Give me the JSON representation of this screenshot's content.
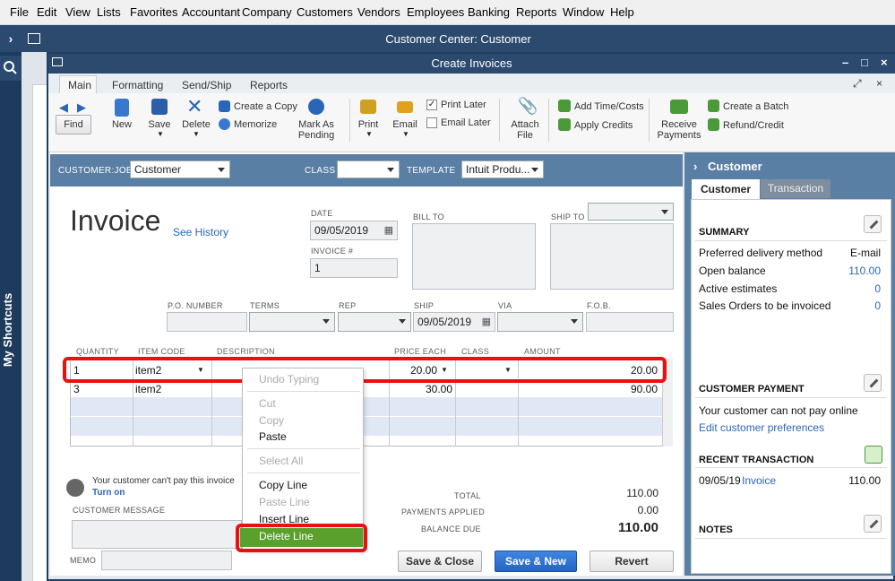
{
  "menubar": {
    "items": [
      "File",
      "Edit",
      "View",
      "Lists",
      "Favorites",
      "Accountant",
      "Company",
      "Customers",
      "Vendors",
      "Employees",
      "Banking",
      "Reports",
      "Window",
      "Help"
    ]
  },
  "shortcuts_label": "My Shortcuts",
  "customer_center_title": "Customer Center: Customer",
  "window_title": "Create Invoices",
  "ribbon_tabs": [
    "Main",
    "Formatting",
    "Send/Ship",
    "Reports"
  ],
  "toolbar": {
    "find": "Find",
    "new": "New",
    "save": "Save",
    "delete": "Delete",
    "create_copy": "Create a Copy",
    "memorize": "Memorize",
    "mark_as_pending": "Mark As Pending",
    "print": "Print",
    "email": "Email",
    "print_later": "Print Later",
    "email_later": "Email Later",
    "attach_file": "Attach File",
    "add_time_costs": "Add Time/Costs",
    "apply_credits": "Apply Credits",
    "receive_payments": "Receive Payments",
    "create_batch": "Create a Batch",
    "refund_credit": "Refund/Credit"
  },
  "header": {
    "customer_job_label": "CUSTOMER:JOB",
    "customer_job_value": "Customer",
    "class_label": "CLASS",
    "class_value": "",
    "template_label": "TEMPLATE",
    "template_value": "Intuit Produ..."
  },
  "invoice": {
    "title": "Invoice",
    "see_history": "See History",
    "date_label": "DATE",
    "date_value": "09/05/2019",
    "invoice_no_label": "INVOICE #",
    "invoice_no_value": "1",
    "bill_to_label": "BILL TO",
    "ship_to_label": "SHIP TO",
    "po_label": "P.O. NUMBER",
    "terms_label": "TERMS",
    "rep_label": "REP",
    "ship_label": "SHIP",
    "ship_value": "09/05/2019",
    "via_label": "VIA",
    "fob_label": "F.O.B."
  },
  "line_items": {
    "headers": [
      "QUANTITY",
      "ITEM CODE",
      "DESCRIPTION",
      "PRICE EACH",
      "CLASS",
      "AMOUNT"
    ],
    "rows": [
      {
        "qty": "1",
        "item": "item2",
        "desc": "",
        "price": "20.00",
        "class": "",
        "amount": "20.00"
      },
      {
        "qty": "3",
        "item": "item2",
        "desc": "",
        "price": "30.00",
        "class": "",
        "amount": "90.00"
      }
    ]
  },
  "context_menu": {
    "items": [
      "Undo Typing",
      "Cut",
      "Copy",
      "Paste",
      "Select All",
      "Copy Line",
      "Paste Line",
      "Insert Line",
      "Delete Line"
    ]
  },
  "footer": {
    "online_pay_msg": "Your customer can't pay this invoice",
    "turn_on": "Turn on",
    "customer_message_label": "CUSTOMER MESSAGE",
    "memo_label": "MEMO",
    "total_label": "TOTAL",
    "total_value": "110.00",
    "payments_applied_label": "PAYMENTS APPLIED",
    "payments_applied_value": "0.00",
    "balance_due_label": "BALANCE DUE",
    "balance_due_value": "110.00",
    "save_close": "Save & Close",
    "save_new": "Save & New",
    "revert": "Revert"
  },
  "sidebar": {
    "title": "Customer",
    "tabs": [
      "Customer",
      "Transaction"
    ],
    "summary_heading": "SUMMARY",
    "summary": [
      {
        "label": "Preferred delivery method",
        "value": "E-mail"
      },
      {
        "label": "Open balance",
        "value": "110.00"
      },
      {
        "label": "Active estimates",
        "value": "0"
      },
      {
        "label": "Sales Orders to be invoiced",
        "value": "0"
      }
    ],
    "payment_heading": "CUSTOMER PAYMENT",
    "payment_msg": "Your customer can not pay online",
    "edit_prefs": "Edit customer preferences",
    "recent_heading": "RECENT TRANSACTION",
    "recent": {
      "date": "09/05/19",
      "type": "Invoice",
      "amount": "110.00"
    },
    "notes_heading": "NOTES"
  },
  "colors": {
    "title_bar": "#2c4a6e",
    "header_band": "#5a7fa4",
    "highlight_red": "#e81010",
    "menu_green": "#5aa02c",
    "link_blue": "#2a66b8"
  }
}
